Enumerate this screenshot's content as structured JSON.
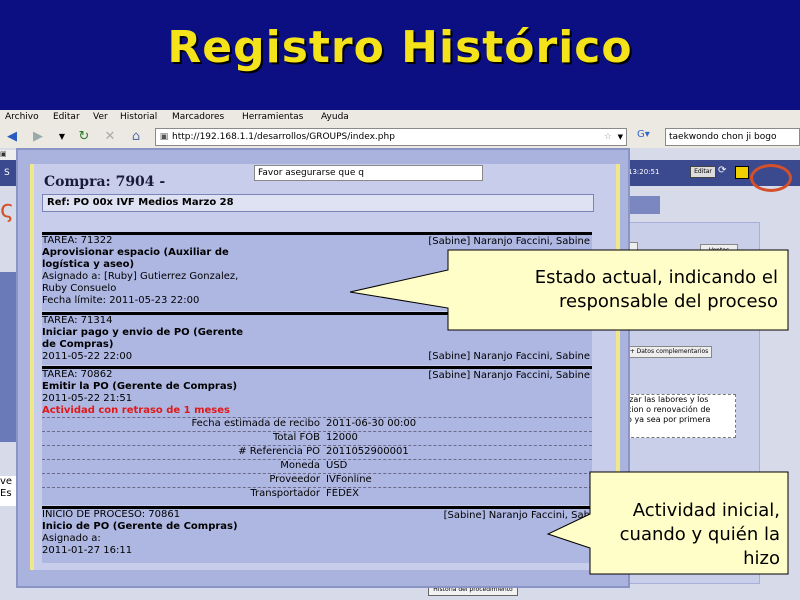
{
  "slide": {
    "title": "Registro Histórico"
  },
  "browser": {
    "menu": [
      "Archivo",
      "Editar",
      "Ver",
      "Historial",
      "Marcadores",
      "Herramientas",
      "Ayuda"
    ],
    "url": "http://192.168.1.1/desarrollos/GROUPS/index.php",
    "search": "taekwondo chon ji bogo"
  },
  "app": {
    "time": "13:20:51",
    "edit_label": "Editar",
    "datos_label": "+ Datos complementarios",
    "ventas_label": "Ventas",
    "right_text": "izar las labores y los\ncion o renovación de\no ya sea por primera",
    "favor_text": "Favor asegurarse que q",
    "historia_button": "Historia del procedimiento",
    "left_frag": "ve\nEs"
  },
  "panel": {
    "compra": "Compra: 7904 -",
    "ref": "Ref: PO 00x IVF Medios Marzo 28",
    "tasks": [
      {
        "tarea": "TAREA: 71322",
        "responsable": "[Sabine] Naranjo Faccini, Sabine",
        "name1": "Aprovisionar espacio (Auxiliar de",
        "name2": "logística y aseo)",
        "asignado1": "Asignado a: [Ruby] Gutierrez Gonzalez,",
        "asignado2": "Ruby Consuelo",
        "fecha": "Fecha límite: 2011-05-23 22:00"
      },
      {
        "tarea": "TAREA: 71314",
        "name1": "Iniciar pago y envio de PO (Gerente",
        "name2": "de Compras)",
        "fecha": "2011-05-22 22:00",
        "responsable": "[Sabine] Naranjo Faccini, Sabine"
      },
      {
        "tarea": "TAREA: 70862",
        "responsable": "[Sabine] Naranjo Faccini, Sabine",
        "name1": "Emitir la PO (Gerente de Compras)",
        "fecha": "2011-05-22 21:51",
        "retraso": "Actividad con retraso de 1 meses",
        "details": [
          {
            "k": "Fecha estimada de recibo",
            "v": "2011-06-30 00:00"
          },
          {
            "k": "Total FOB",
            "v": "12000"
          },
          {
            "k": "# Referencia PO",
            "v": "2011052900001"
          },
          {
            "k": "Moneda",
            "v": "USD"
          },
          {
            "k": "Proveedor",
            "v": "IVFonline"
          },
          {
            "k": "Transportador",
            "v": "FEDEX"
          }
        ]
      },
      {
        "tarea": "INICIO DE PROCESO: 70861",
        "responsable": "[Sabine] Naranjo Faccini, Sab",
        "name1": "Inicio de PO (Gerente de Compras)",
        "asignado1": "Asignado a:",
        "fecha": "2011-01-27 16:11"
      }
    ]
  },
  "callouts": {
    "estado": "Estado actual, indicando el responsable del proceso",
    "inicial": "Actividad inicial, cuando y quién la hizo"
  },
  "colors": {
    "title_bg": "#0b0f82",
    "title_fg": "#f4e21a",
    "late": "#e01818",
    "callout_bg": "#fffdc8"
  }
}
